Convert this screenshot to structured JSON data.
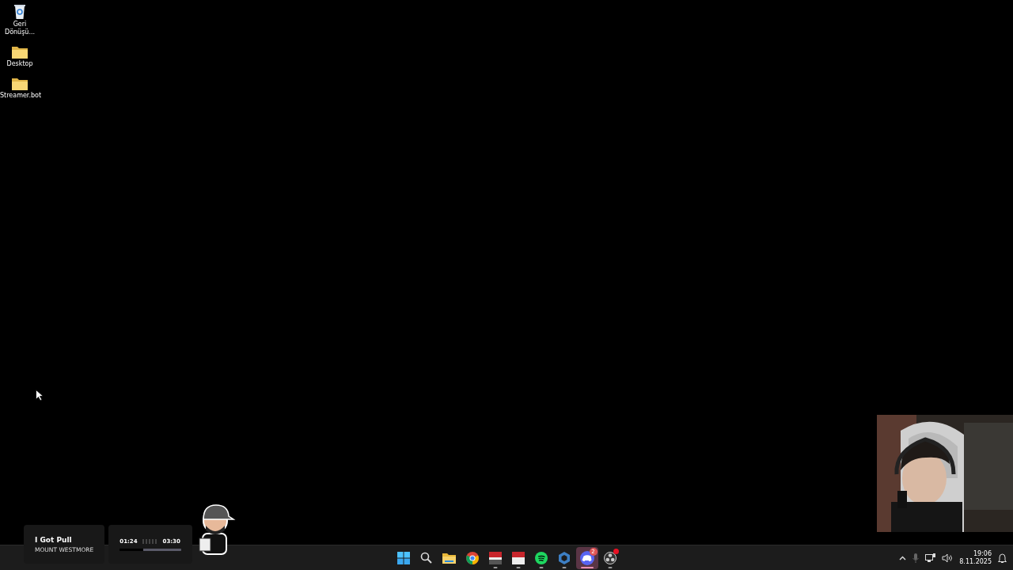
{
  "desktop_icons": [
    {
      "kind": "recycle",
      "label": "Geri Dönüşü..."
    },
    {
      "kind": "folder",
      "label": "Desktop"
    },
    {
      "kind": "folder",
      "label": "Streamer.bot"
    }
  ],
  "media_widget": {
    "title": "I Got Pull",
    "artist": "MOUNT WESTMORE",
    "elapsed": "01:24",
    "duration": "03:30",
    "level": 0.38
  },
  "taskbar": {
    "apps": [
      {
        "kind": "start",
        "running": false,
        "selected": false
      },
      {
        "kind": "search",
        "running": false,
        "selected": false
      },
      {
        "kind": "explorer",
        "running": false,
        "selected": false
      },
      {
        "kind": "chrome",
        "running": false,
        "selected": false
      },
      {
        "kind": "mixer",
        "running": true,
        "selected": false
      },
      {
        "kind": "mixer2",
        "running": true,
        "selected": false
      },
      {
        "kind": "spotify",
        "running": true,
        "selected": false
      },
      {
        "kind": "hexapp",
        "running": true,
        "selected": false
      },
      {
        "kind": "discord",
        "running": true,
        "selected": true,
        "badge": "2"
      },
      {
        "kind": "obs",
        "running": true,
        "selected": false,
        "alert": true
      }
    ],
    "tray": {
      "time": "19:06",
      "date": "8.11.2025"
    }
  }
}
